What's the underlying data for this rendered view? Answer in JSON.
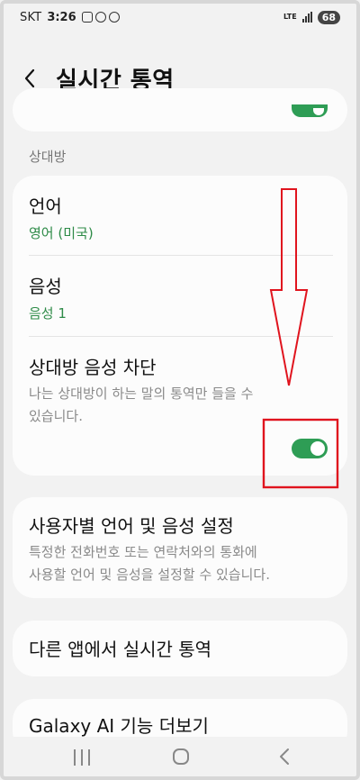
{
  "status_bar": {
    "carrier": "SKT",
    "time": "3:26",
    "network": "LTE",
    "battery": "68"
  },
  "header": {
    "title": "실시간 통역",
    "back_icon": "chevron-left-icon"
  },
  "section": {
    "label": "상대방"
  },
  "rows": {
    "language": {
      "title": "언어",
      "value": "영어 (미국)"
    },
    "voice": {
      "title": "음성",
      "value": "음성 1"
    },
    "mute": {
      "title": "상대방 음성 차단",
      "description_line1": "나는 상대방이 하는 말의 통역만 들을 수",
      "description_line2": "있습니다.",
      "enabled": true
    },
    "custom": {
      "title": "사용자별 언어 및 음성 설정",
      "description_line1": "특정한 전화번호 또는 연락처와의 통화에",
      "description_line2": "사용할 언어 및 음성을 설정할 수 있습니다."
    },
    "other_apps": {
      "title": "다른 앱에서 실시간 통역"
    },
    "galaxy_ai": {
      "title": "Galaxy AI 기능 더보기"
    }
  },
  "colors": {
    "accent_green": "#2e9d55",
    "annotation_red": "#e0141e",
    "background": "#f2f2f2",
    "card": "#fcfcfc"
  },
  "nav_bar": {
    "recents_icon": "recents-icon",
    "home_icon": "home-icon",
    "back_icon": "back-icon"
  }
}
